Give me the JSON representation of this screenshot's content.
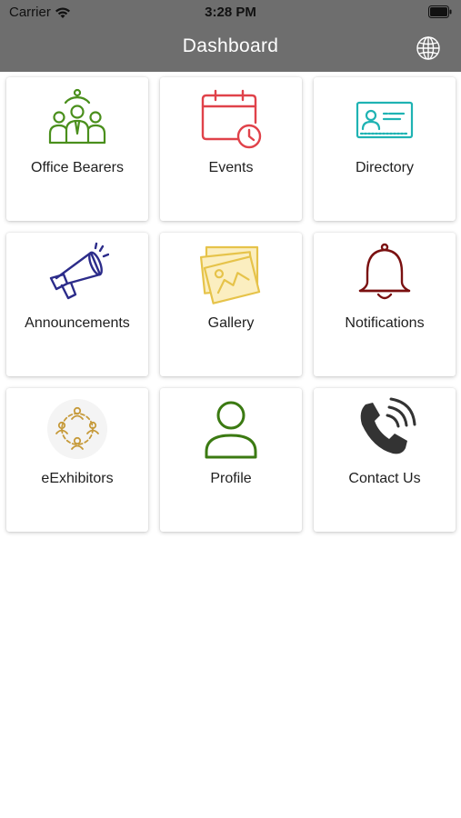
{
  "status_bar": {
    "carrier": "Carrier",
    "time": "3:28 PM"
  },
  "nav": {
    "title": "Dashboard"
  },
  "tiles": [
    {
      "label": "Office Bearers",
      "icon": "people-group-icon",
      "color": "#4a8f1c"
    },
    {
      "label": "Events",
      "icon": "calendar-clock-icon",
      "color": "#e0424a"
    },
    {
      "label": "Directory",
      "icon": "id-card-icon",
      "color": "#1fb3b3"
    },
    {
      "label": "Announcements",
      "icon": "megaphone-icon",
      "color": "#2c2c8a"
    },
    {
      "label": "Gallery",
      "icon": "photo-stack-icon",
      "color": "#e6c34a"
    },
    {
      "label": "Notifications",
      "icon": "bell-icon",
      "color": "#7a1010"
    },
    {
      "label": "eExhibitors",
      "icon": "network-people-icon",
      "color": "#c69a3a"
    },
    {
      "label": "Profile",
      "icon": "user-icon",
      "color": "#3b7a12"
    },
    {
      "label": "Contact Us",
      "icon": "phone-ringing-icon",
      "color": "#333333"
    }
  ],
  "colors": {
    "header_bg": "#6e6e6e",
    "header_text": "#ffffff",
    "page_bg": "#ffffff"
  }
}
